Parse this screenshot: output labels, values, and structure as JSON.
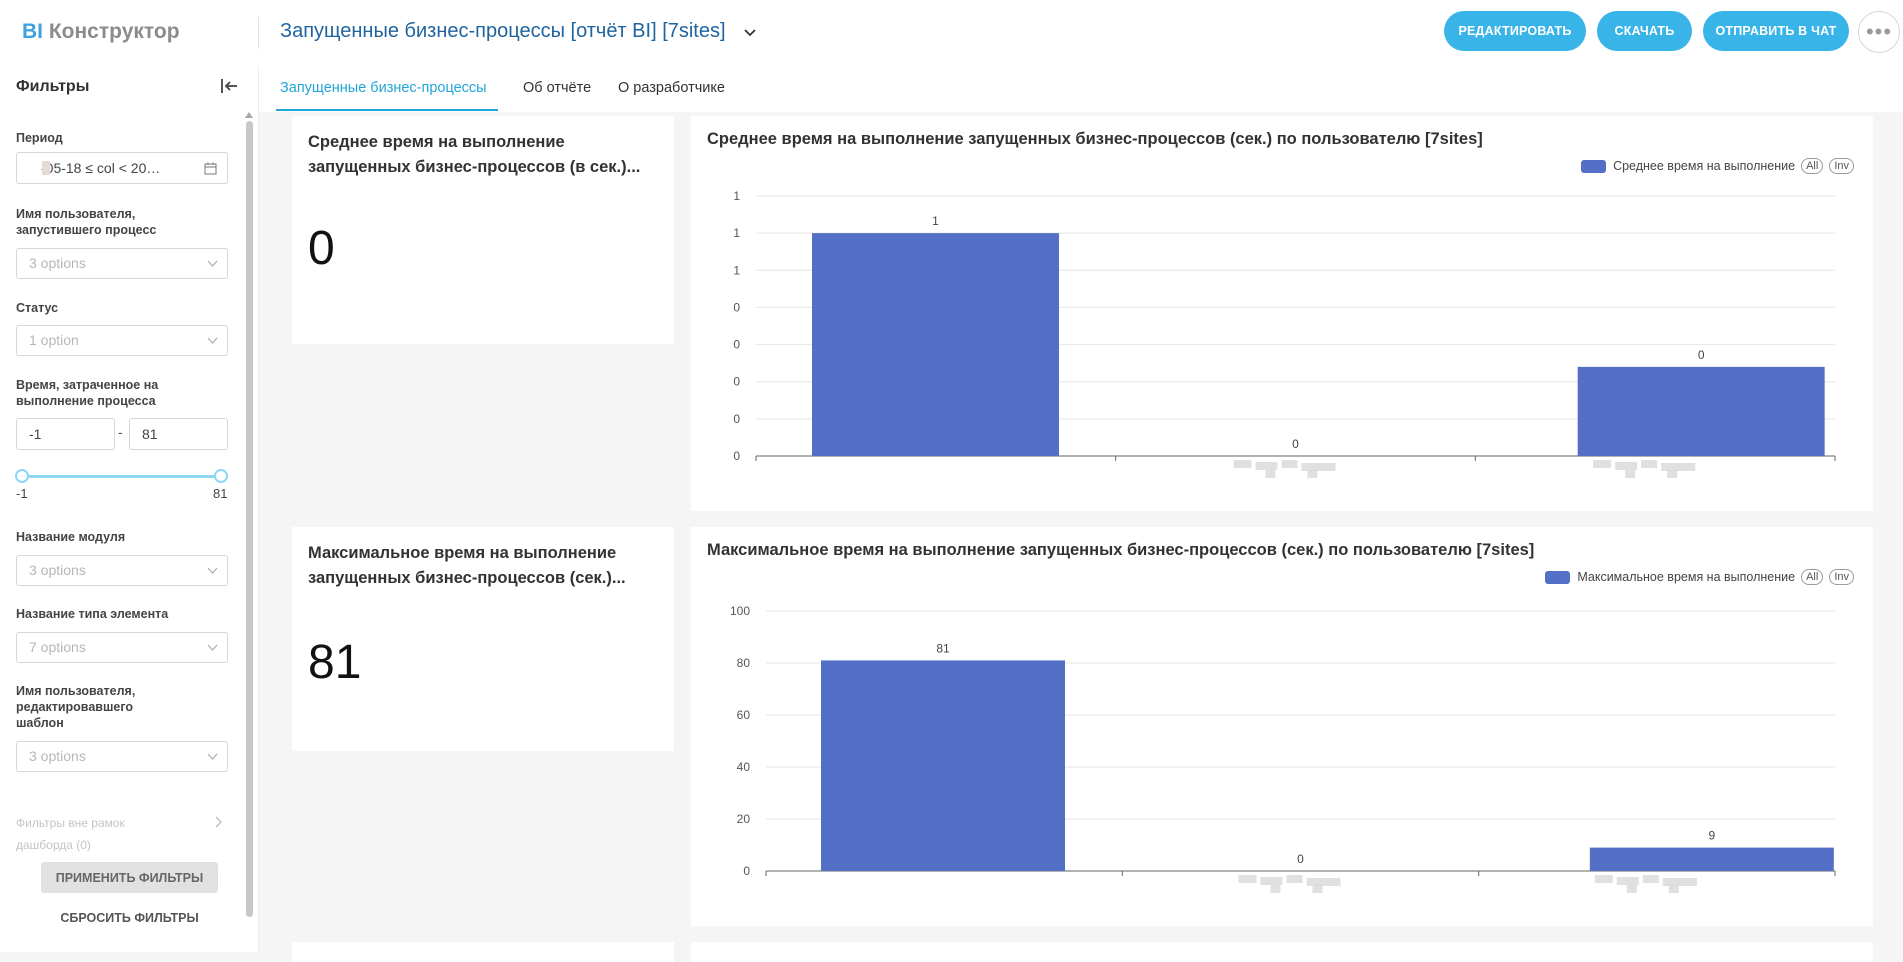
{
  "header": {
    "logo_bi": "BI",
    "logo_brand": "Конструктор",
    "report_title": "Запущенные бизнес-процессы [отчёт BI] [7sites]",
    "edit_label": "РЕДАКТИРОВАТЬ",
    "download_label": "СКАЧАТЬ",
    "send_label": "ОТПРАВИТЬ В ЧАТ",
    "more_label": "•••"
  },
  "sidebar": {
    "title": "Фильтры",
    "period_label": "Период",
    "period_value": "-05-18 ≤ col < 20…",
    "user_started_label": "Имя пользователя, запустившего процесс",
    "user_started_value": "3 options",
    "status_label": "Статус",
    "status_value": "1 option",
    "time_label": "Время, затраченное на выполнение процесса",
    "time_min": "-1",
    "time_max": "81",
    "time_separator": "-",
    "slider_min_label": "-1",
    "slider_max_label": "81",
    "module_label": "Название модуля",
    "module_value": "3 options",
    "element_type_label": "Название типа элемента",
    "element_type_value": "7 options",
    "user_edited_label": "Имя пользователя, редактировавшего шаблон",
    "user_edited_value": "3 options",
    "outside_filters": "Фильтры вне рамок дашборда (0)",
    "apply_label": "ПРИМЕНИТЬ ФИЛЬТРЫ",
    "reset_label": "СБРОСИТЬ ФИЛЬТРЫ"
  },
  "tabs": [
    {
      "label": "Запущенные бизнес-процессы"
    },
    {
      "label": "Об отчёте"
    },
    {
      "label": "О разработчике"
    }
  ],
  "cards": {
    "avg_big": {
      "title": "Среднее время на выполнение запущенных бизнес-процессов (в сек.)...",
      "value": "0"
    },
    "max_big": {
      "title": "Максимальное время на выполнение запущенных бизнес-процессов (сек.)...",
      "value": "81"
    }
  },
  "chart_data": [
    {
      "type": "bar",
      "title": "Среднее время на выполнение запущенных бизнес-процессов (сек.) по пользователю [7sites]",
      "legend": "Среднее время на выполнение",
      "legend_position": "top-right",
      "legend_buttons": [
        "All",
        "Inv"
      ],
      "categories": [
        "",
        "",
        ""
      ],
      "values": [
        0.6,
        0,
        0.24
      ],
      "data_labels": [
        "1",
        "0",
        "0"
      ],
      "ytick_labels": [
        "0",
        "0",
        "0",
        "0",
        "0",
        "1",
        "1",
        "1"
      ],
      "ylim": [
        0,
        0.7
      ],
      "grid": true,
      "color": "#5470c6"
    },
    {
      "type": "bar",
      "title": "Максимальное время на выполнение запущенных бизнес-процессов (сек.) по пользователю [7sites]",
      "legend": "Максимальное время на выполнение",
      "legend_position": "top-right",
      "legend_buttons": [
        "All",
        "Inv"
      ],
      "categories": [
        "",
        "",
        ""
      ],
      "values": [
        81,
        0,
        9
      ],
      "data_labels": [
        "81",
        "0",
        "9"
      ],
      "ytick_labels": [
        "0",
        "20",
        "40",
        "60",
        "80",
        "100"
      ],
      "ylim": [
        0,
        100
      ],
      "grid": true,
      "color": "#5470c6"
    }
  ]
}
